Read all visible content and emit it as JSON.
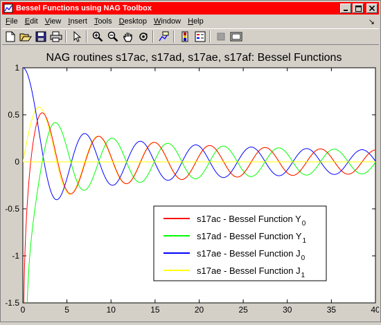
{
  "window": {
    "title": "Bessel Functions using NAG Toolbox",
    "controls": [
      "minimize",
      "maximize",
      "close"
    ]
  },
  "menubar": {
    "items": [
      {
        "label": "File",
        "key": "F",
        "rest": "ile"
      },
      {
        "label": "Edit",
        "key": "E",
        "rest": "dit"
      },
      {
        "label": "View",
        "key": "V",
        "rest": "iew"
      },
      {
        "label": "Insert",
        "key": "I",
        "rest": "nsert"
      },
      {
        "label": "Tools",
        "key": "T",
        "rest": "ools"
      },
      {
        "label": "Desktop",
        "key": "D",
        "rest": "esktop"
      },
      {
        "label": "Window",
        "key": "W",
        "rest": "indow"
      },
      {
        "label": "Help",
        "key": "H",
        "rest": "elp"
      }
    ],
    "arrow": "↘"
  },
  "toolbar": {
    "buttons": [
      "new-figure-icon",
      "open-file-icon",
      "save-icon",
      "print-icon",
      "edit-plot-arrow-icon",
      "zoom-in-icon",
      "zoom-out-icon",
      "pan-hand-icon",
      "rotate-3d-icon",
      "data-cursor-icon",
      "colorbar-icon",
      "legend-icon",
      "hide-plot-tools-icon",
      "show-plot-tools-icon"
    ]
  },
  "colors": {
    "titlebar": "#ff0000",
    "Y0": "#ff0000",
    "Y1": "#00ff00",
    "J0": "#0000ff",
    "J1": "#ffff00"
  },
  "chart_data": {
    "type": "line",
    "title": "NAG routines s17ac, s17ad, s17ae, s17af: Bessel Functions",
    "xlabel": "",
    "ylabel": "",
    "xlim": [
      0,
      40
    ],
    "ylim": [
      -1.5,
      1
    ],
    "xticks": [
      "0",
      "5",
      "10",
      "15",
      "20",
      "25",
      "30",
      "35",
      "40"
    ],
    "yticks": [
      "1",
      "0.5",
      "0",
      "-0.5",
      "-1",
      "-1.5"
    ],
    "legend_position": "bottom-right",
    "grid": false,
    "x": [
      0,
      1,
      2,
      3,
      4,
      5,
      6,
      7,
      8,
      9,
      10,
      11,
      12,
      13,
      14,
      15,
      16,
      17,
      18,
      19,
      20,
      21,
      22,
      23,
      24,
      25,
      26,
      27,
      28,
      29,
      30,
      31,
      32,
      33,
      34,
      35,
      36,
      37,
      38,
      39,
      40
    ],
    "series": [
      {
        "name": "s17ac - Bessel Function Y",
        "sub": "0",
        "color": "#ff0000",
        "function": "Y0",
        "note_x_start": 0.1,
        "values": [
          null,
          0.088,
          0.51,
          0.377,
          -0.017,
          -0.309,
          -0.288,
          -0.026,
          0.223,
          0.249,
          0.056,
          -0.168,
          -0.225,
          -0.078,
          0.127,
          0.205,
          0.096,
          -0.094,
          -0.187,
          -0.106,
          0.063,
          0.171,
          0.112,
          -0.038,
          -0.155,
          -0.123,
          0.013,
          0.138,
          0.121,
          0.005,
          -0.123,
          -0.126,
          -0.028,
          0.101,
          0.125,
          0.046,
          -0.081,
          -0.12,
          -0.062,
          0.059,
          0.109
        ]
      },
      {
        "name": "s17ad - Bessel Function Y",
        "sub": "1",
        "color": "#00ff00",
        "function": "Y1",
        "values": [
          null,
          -0.781,
          -0.107,
          0.325,
          0.398,
          0.148,
          -0.175,
          -0.303,
          -0.158,
          0.104,
          0.249,
          0.164,
          -0.057,
          -0.21,
          -0.167,
          0.021,
          0.178,
          0.168,
          0.008,
          -0.151,
          -0.165,
          -0.031,
          0.13,
          0.161,
          0.051,
          -0.107,
          -0.154,
          -0.063,
          0.087,
          0.145,
          0.075,
          -0.067,
          -0.136,
          -0.086,
          0.048,
          0.128,
          0.094,
          -0.029,
          -0.117,
          -0.1,
          0.013
        ]
      },
      {
        "name": "s17ae - Bessel Function J",
        "sub": "0",
        "color": "#0000ff",
        "function": "J0",
        "values": [
          1,
          0.765,
          0.224,
          -0.26,
          -0.397,
          -0.178,
          0.151,
          0.3,
          0.172,
          -0.09,
          -0.246,
          -0.171,
          0.048,
          0.207,
          0.171,
          -0.014,
          -0.175,
          -0.17,
          -0.014,
          0.147,
          0.167,
          0.037,
          -0.121,
          -0.162,
          -0.057,
          0.096,
          0.156,
          0.073,
          -0.073,
          -0.148,
          -0.086,
          0.052,
          0.139,
          0.096,
          -0.033,
          -0.129,
          -0.104,
          0.015,
          0.12,
          0.109,
          0.007
        ]
      },
      {
        "name": "s17ae - Bessel Function J",
        "sub": "1",
        "color": "#ffff00",
        "function": "J1",
        "values": [
          0,
          0.44,
          0.577,
          0.339,
          -0.066,
          -0.328,
          -0.277,
          -0.005,
          0.235,
          0.245,
          0.043,
          -0.177,
          -0.223,
          -0.07,
          0.133,
          0.205,
          0.09,
          -0.098,
          -0.188,
          -0.105,
          0.067,
          0.171,
          0.117,
          -0.04,
          -0.154,
          -0.125,
          0.017,
          0.137,
          0.131,
          0.003,
          -0.119,
          -0.133,
          -0.024,
          0.101,
          0.133,
          0.042,
          -0.085,
          -0.13,
          -0.058,
          0.068,
          0.126
        ]
      }
    ]
  }
}
